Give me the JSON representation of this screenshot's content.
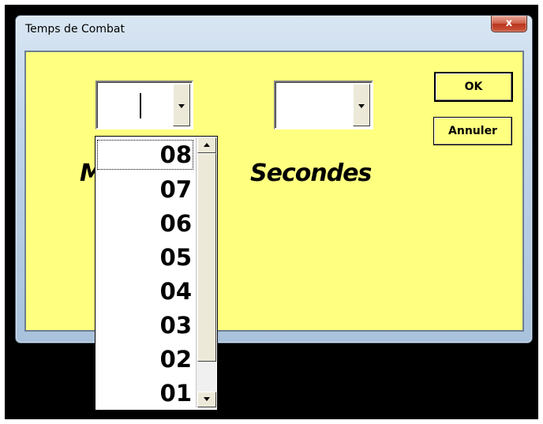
{
  "window": {
    "title": "Temps de Combat",
    "close_glyph": "x"
  },
  "form": {
    "minutes_label": "M",
    "seconds_label": "Secondes",
    "minutes_value": "",
    "seconds_value": ""
  },
  "buttons": {
    "ok": "OK",
    "cancel": "Annuler"
  },
  "dropdown": {
    "items": [
      "08",
      "07",
      "06",
      "05",
      "04",
      "03",
      "02",
      "01"
    ]
  },
  "colors": {
    "dialog_bg": "#ffff80",
    "desktop": "#000000"
  },
  "icons": [
    "close-icon",
    "chevron-down-icon",
    "scroll-up-icon",
    "scroll-down-icon"
  ]
}
